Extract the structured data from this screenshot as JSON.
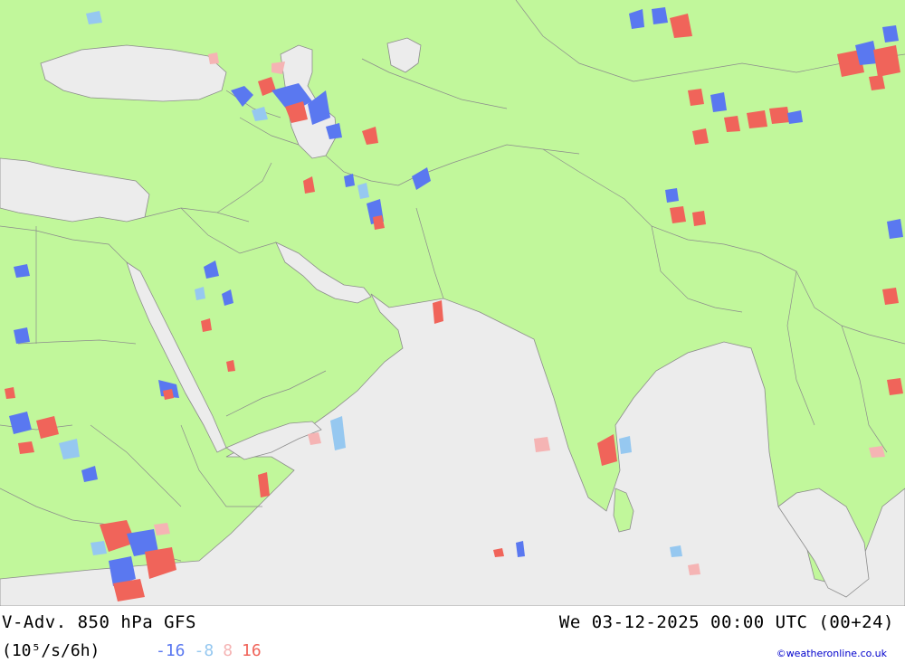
{
  "header": {
    "title_left": "V-Adv. 850 hPa  GFS",
    "title_right": "We 03-12-2025 00:00 UTC (00+24)",
    "units": "(10⁵/s/6h)"
  },
  "legend": {
    "items": [
      {
        "label": "-16",
        "color": "#5a78f0"
      },
      {
        "label": "-8",
        "color": "#96c8f0"
      },
      {
        "label": "8",
        "color": "#f5b4b4"
      },
      {
        "label": "16",
        "color": "#f0645a"
      }
    ]
  },
  "credit": "©weatheronline.co.uk",
  "colors": {
    "land": "#c1f79b",
    "sea": "#ececec",
    "border": "#8c8c8c",
    "neg_strong": "#5a78f0",
    "neg_weak": "#96c8f0",
    "pos_weak": "#f5b4b4",
    "pos_strong": "#f0645a"
  }
}
